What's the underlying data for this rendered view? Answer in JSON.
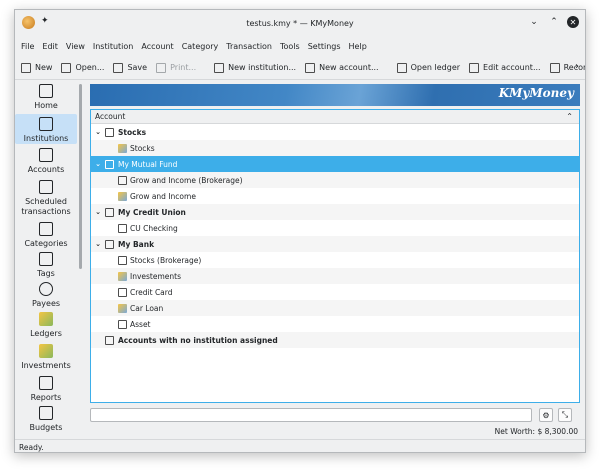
{
  "window": {
    "title": "testus.kmy * — KMyMoney"
  },
  "menu": [
    "File",
    "Edit",
    "View",
    "Institution",
    "Account",
    "Category",
    "Transaction",
    "Tools",
    "Settings",
    "Help"
  ],
  "toolbar": {
    "new": "New",
    "open": "Open...",
    "save": "Save",
    "print": "Print...",
    "new_institution": "New institution...",
    "new_account": "New account...",
    "open_ledger": "Open ledger",
    "edit_account": "Edit account...",
    "reconcile": "Reconcile..."
  },
  "sidebar": {
    "home": "Home",
    "institutions": "Institutions",
    "accounts": "Accounts",
    "scheduled_1": "Scheduled",
    "scheduled_2": "transactions",
    "categories": "Categories",
    "tags": "Tags",
    "payees": "Payees",
    "ledgers": "Ledgers",
    "investments": "Investments",
    "reports": "Reports",
    "budgets": "Budgets"
  },
  "banner": {
    "brand": "KMyMoney"
  },
  "tree": {
    "header": "Account",
    "rows": [
      "Stocks",
      "Stocks",
      "My Mutual Fund",
      "Grow and Income (Brokerage)",
      "Grow and Income",
      "My Credit Union",
      "CU Checking",
      "My Bank",
      "Stocks (Brokerage)",
      "Investements",
      "Credit Card",
      "Car Loan",
      "Asset",
      "Accounts with no institution assigned"
    ]
  },
  "footer": {
    "networth": "Net Worth: $ 8,300.00"
  },
  "status": "Ready."
}
